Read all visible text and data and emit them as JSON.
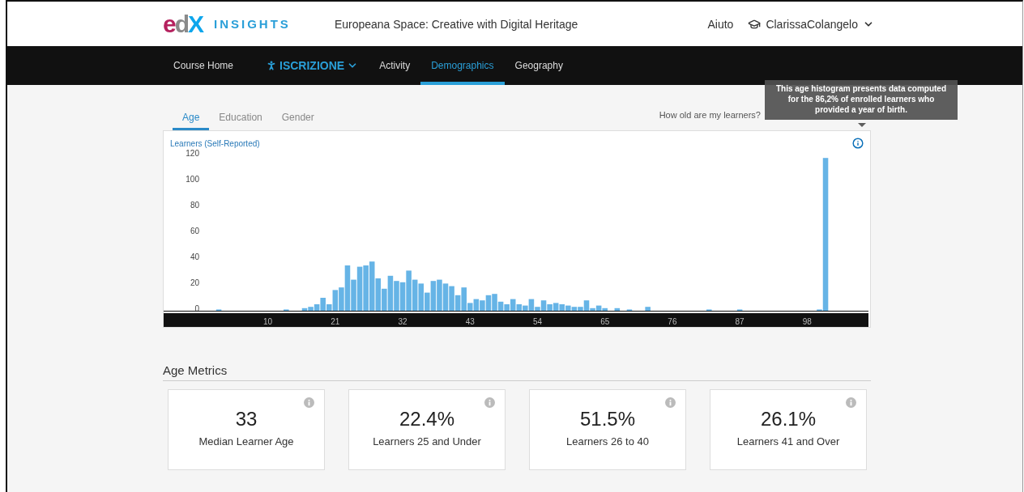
{
  "header": {
    "logo": "edX",
    "product": "INSIGHTS",
    "course_title": "Europeana Space: Creative with Digital Heritage",
    "help_link": "Aiuto",
    "user": "ClarissaColangelo"
  },
  "nav": [
    {
      "label": "Course Home",
      "kind": "link",
      "selected": false
    },
    {
      "label": "ISCRIZIONE",
      "kind": "dropdown",
      "selected": false
    },
    {
      "label": "Activity",
      "kind": "link",
      "selected": false
    },
    {
      "label": "Demographics",
      "kind": "link",
      "selected": true
    },
    {
      "label": "Geography",
      "kind": "link",
      "selected": false
    }
  ],
  "tabs": [
    {
      "label": "Age",
      "selected": true
    },
    {
      "label": "Education",
      "selected": false
    },
    {
      "label": "Gender",
      "selected": false
    }
  ],
  "section_question": "How old are my learners?",
  "tooltip": "This age histogram presents data computed for the 86,2% of enrolled learners who provided a year of birth.",
  "chart": {
    "chart_data": {
      "type": "bar",
      "ylabel": "Learners (Self-Reported)",
      "x": [
        0,
        1,
        2,
        3,
        4,
        5,
        6,
        7,
        8,
        9,
        10,
        11,
        12,
        13,
        14,
        15,
        16,
        17,
        18,
        19,
        20,
        21,
        22,
        23,
        24,
        25,
        26,
        27,
        28,
        29,
        30,
        31,
        32,
        33,
        34,
        35,
        36,
        37,
        38,
        39,
        40,
        41,
        42,
        43,
        44,
        45,
        46,
        47,
        48,
        49,
        50,
        51,
        52,
        53,
        54,
        55,
        56,
        57,
        58,
        59,
        60,
        61,
        62,
        63,
        64,
        65,
        66,
        67,
        68,
        69,
        70,
        71,
        72,
        73,
        74,
        75,
        76,
        77,
        78,
        79,
        80,
        81,
        82,
        83,
        84,
        85,
        86,
        87,
        88,
        89,
        90,
        91,
        92,
        93,
        94,
        95,
        96,
        97,
        98,
        99,
        100,
        101,
        102,
        103,
        104
      ],
      "values": [
        0,
        0,
        1,
        0,
        0,
        0,
        0,
        0,
        0,
        0,
        0,
        0,
        0,
        1,
        0,
        0,
        2,
        3,
        5,
        10,
        5,
        16,
        18,
        35,
        24,
        34,
        35,
        38,
        25,
        17,
        27,
        23,
        22,
        31,
        24,
        21,
        14,
        23,
        24,
        21,
        19,
        12,
        18,
        6,
        9,
        8,
        12,
        13,
        7,
        5,
        9,
        5,
        4,
        9,
        3,
        8,
        5,
        6,
        5,
        4,
        3,
        3,
        8,
        2,
        4,
        2,
        0,
        2,
        0,
        1,
        0,
        0,
        3,
        0,
        0,
        0,
        0,
        0,
        0,
        0,
        0,
        0,
        1,
        0,
        0,
        0,
        0,
        1,
        0,
        0,
        0,
        0,
        0,
        0,
        0,
        0,
        0,
        0,
        0,
        0,
        1,
        118,
        0,
        0,
        0
      ],
      "xlim": [
        -7,
        108
      ],
      "ylim": [
        0,
        120
      ],
      "xticks": [
        10,
        21,
        32,
        43,
        54,
        65,
        76,
        87,
        98
      ],
      "yticks": [
        0,
        20,
        40,
        60,
        80,
        100,
        120
      ]
    }
  },
  "metrics": {
    "title": "Age Metrics",
    "cards": [
      {
        "value": "33",
        "label": "Median Learner Age"
      },
      {
        "value": "22.4%",
        "label": "Learners 25 and Under"
      },
      {
        "value": "51.5%",
        "label": "Learners 26 to 40"
      },
      {
        "value": "26.1%",
        "label": "Learners 41 and Over"
      }
    ]
  }
}
